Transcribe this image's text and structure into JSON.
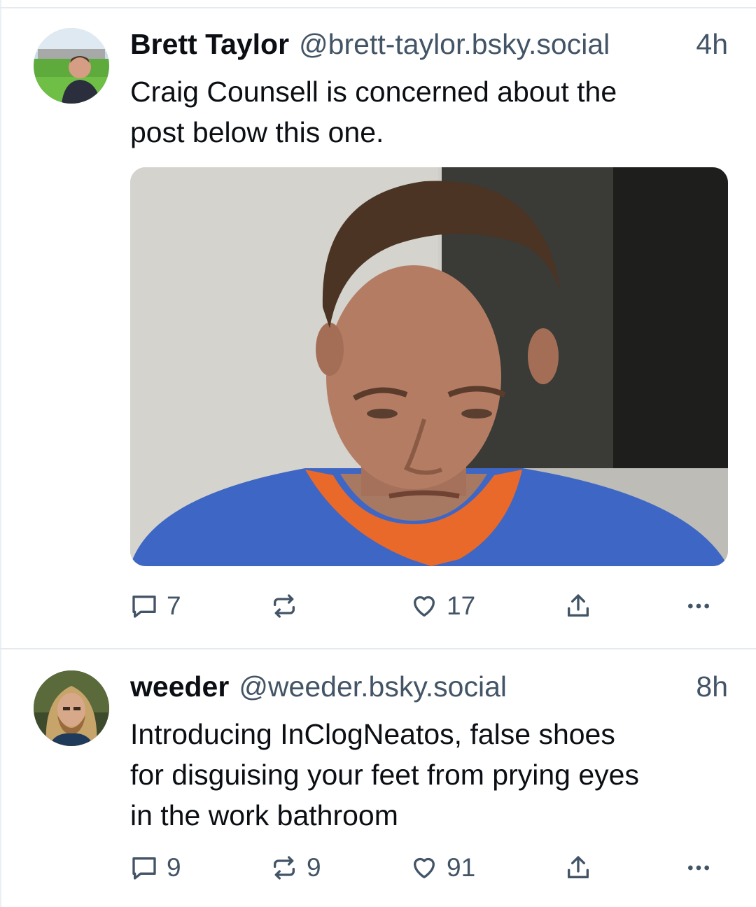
{
  "posts": [
    {
      "author_name": "Brett Taylor",
      "author_handle": "@brett-taylor.bsky.social",
      "time": "4h",
      "text_lines": [
        "Craig Counsell is concerned about the",
        "post below this one."
      ],
      "has_image": true,
      "counts": {
        "replies": "7",
        "reposts": "",
        "likes": "17"
      }
    },
    {
      "author_name": "weeder",
      "author_handle": "@weeder.bsky.social",
      "time": "8h",
      "text_lines": [
        "Introducing InClogNeatos, false shoes",
        "for disguising your feet from prying eyes",
        "in the work bathroom"
      ],
      "has_image": false,
      "counts": {
        "replies": "9",
        "reposts": "9",
        "likes": "91"
      }
    }
  ],
  "icons": {
    "reply": "speech-bubble-icon",
    "repost": "repost-arrows-icon",
    "like": "heart-icon",
    "share": "share-arrow-icon",
    "more": "ellipsis-icon"
  },
  "colors": {
    "muted_text": "#425466",
    "divider": "#e6e9ee"
  }
}
